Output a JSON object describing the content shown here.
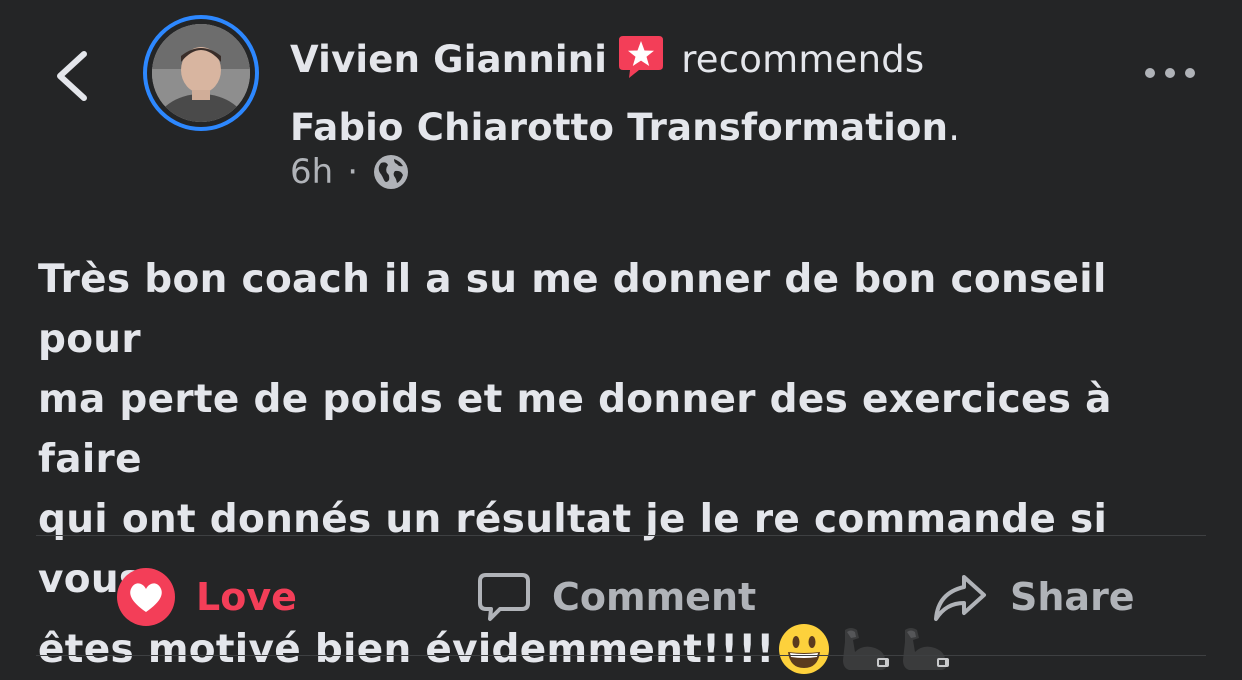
{
  "post": {
    "author": "Vivien Giannini",
    "verb": "recommends",
    "page": "Fabio Chiarotto Transformation",
    "page_suffix": ".",
    "time": "6h",
    "separator": "·",
    "audience_icon": "globe-icon",
    "body_lines": [
      "Très bon coach il a su me donner de bon conseil pour",
      "ma perte de poids et me donner des exercices à faire",
      "qui ont donnés un résultat je le re commande si vous",
      "êtes motivé bien évidemment!!!!"
    ],
    "emojis": [
      "😃",
      "💪",
      "💪"
    ]
  },
  "actions": {
    "love": "Love",
    "comment": "Comment",
    "share": "Share"
  },
  "colors": {
    "background": "#242526",
    "love": "#f33e58",
    "avatar_ring": "#2d88ff",
    "muted": "#b0b3b8",
    "badge": "#f33e58"
  },
  "icons": {
    "back": "chevron-left-icon",
    "more": "more-horizontal-icon",
    "badge": "recommend-star-icon",
    "love": "heart-icon",
    "comment": "comment-icon",
    "share": "share-arrow-icon"
  }
}
